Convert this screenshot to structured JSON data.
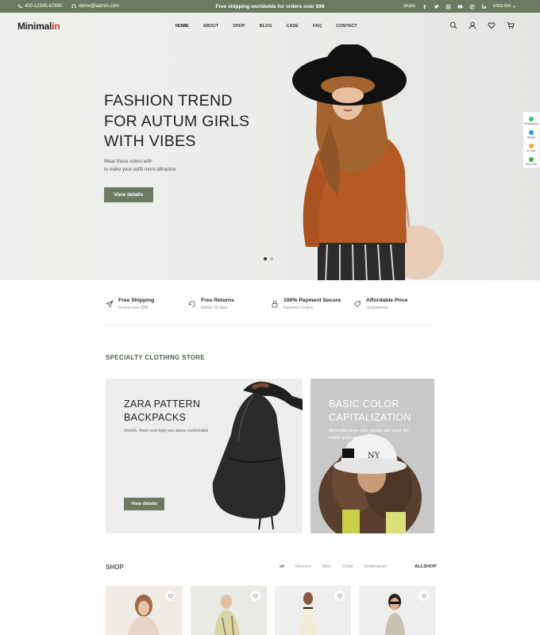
{
  "topbar": {
    "phone": "400-12345-67890",
    "email": "demo@admin.com",
    "promo": "Free shipping worldwide for orders over $99",
    "share_label": "share",
    "language": "ENGLISH"
  },
  "header": {
    "logo_main": "Minimal",
    "logo_accent": "in",
    "nav": [
      "HOME",
      "ABOUT",
      "SHOP",
      "BLOG",
      "CASE",
      "FAQ",
      "CONTACT"
    ]
  },
  "hero": {
    "title_lines": [
      "FASHION TREND",
      "FOR AUTUM GIRLS",
      "WITH VIBES"
    ],
    "subtitle_lines": [
      "Wear these colors with",
      "to make your outfit more attractive"
    ],
    "button": "View details"
  },
  "side_widget": [
    "WhatsApp",
    "Skype",
    "E-Mail",
    "WeChat"
  ],
  "features": [
    {
      "title": "Free Shipping",
      "sub": "Orders over $99",
      "icon": "send-icon"
    },
    {
      "title": "Free Returns",
      "sub": "Within 30 days",
      "icon": "return-icon"
    },
    {
      "title": "100% Payment Secure",
      "sub": "Payment Online",
      "icon": "lock-icon"
    },
    {
      "title": "Affordable Price",
      "sub": "Guaranteed",
      "icon": "tag-icon"
    }
  ],
  "specialty": {
    "title": "SPECIALTY CLOTHING STORE",
    "card1": {
      "title_lines": [
        "ZARA PATTERN",
        "BACKPACKS"
      ],
      "desc": "Stretch, fresh-cool help you alway comfortable",
      "button": "View details"
    },
    "card2": {
      "title_lines": [
        "BASIC COLOR",
        "CAPITALIZATION"
      ],
      "desc": "Minimalist never cool, choose and make the simple great again"
    }
  },
  "shop": {
    "title": "SHOP",
    "filters": [
      "all",
      "Women",
      "Men",
      "Child",
      "Underwear"
    ],
    "all_shop": "ALLSHOP"
  },
  "colors": {
    "accent": "#6c7a63",
    "accent_dark": "#4e5d47",
    "logo_red": "#c0392b"
  }
}
